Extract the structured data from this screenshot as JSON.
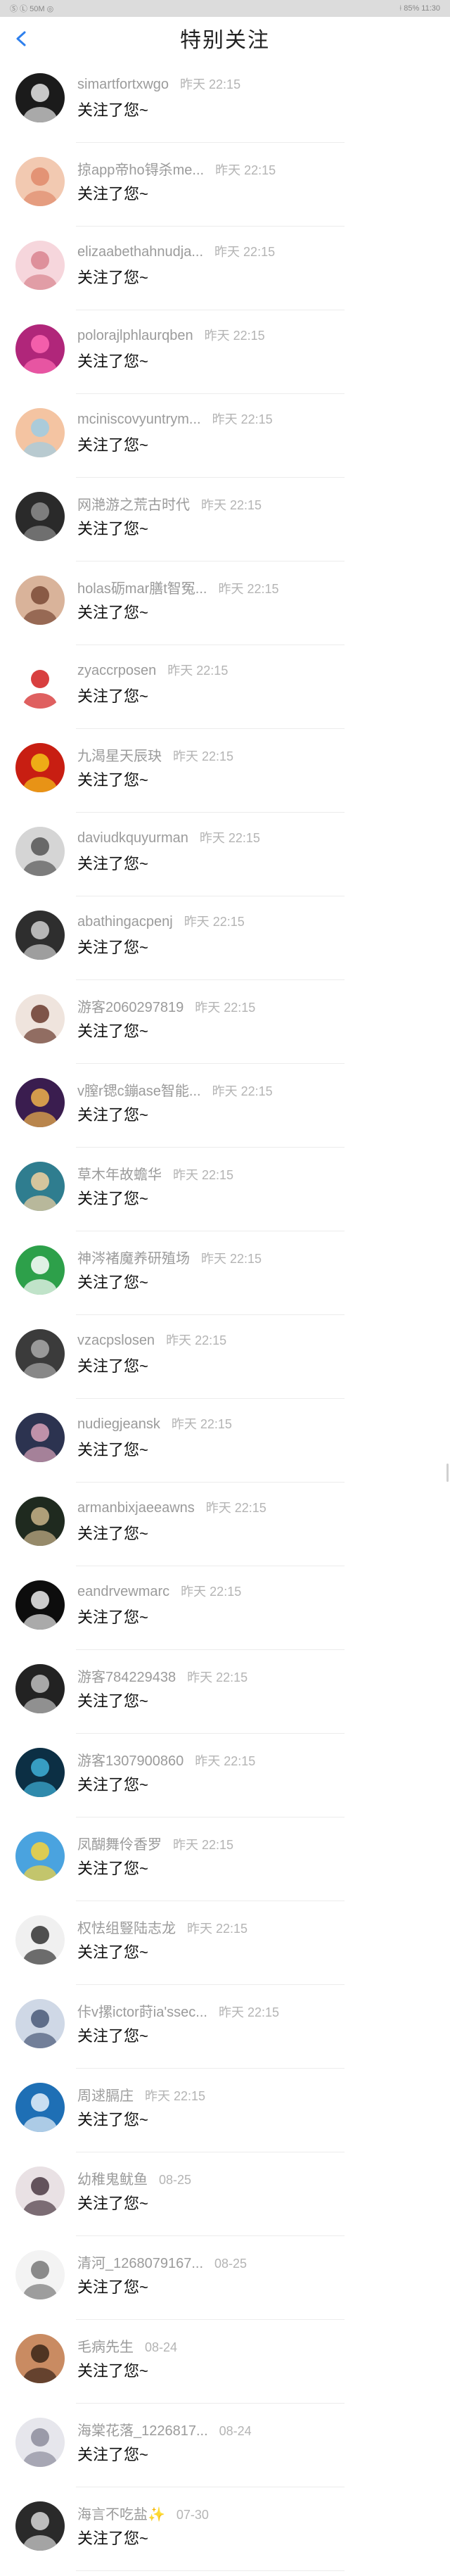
{
  "status_bar": {
    "left": "Ⓢ Ⓛ 50M  ◎  ",
    "right": "⟊ 85%  11:30"
  },
  "header": {
    "title": "特别关注",
    "back_icon": "chevron-left-icon"
  },
  "rows": [
    {
      "name": "simartfortxwgo",
      "time": "昨天 22:15",
      "message": "关注了您~",
      "avatar": {
        "bg": "#1b1b1b",
        "fg": "#e6e6e6"
      }
    },
    {
      "name": "掠app帝ho锝杀me...",
      "time": "昨天 22:15",
      "message": "关注了您~",
      "avatar": {
        "bg": "#f2c9b1",
        "fg": "#e08a6b"
      }
    },
    {
      "name": "elizaabethahnudja...",
      "time": "昨天 22:15",
      "message": "关注了您~",
      "avatar": {
        "bg": "#f6d6dc",
        "fg": "#d9848f"
      }
    },
    {
      "name": "polorajlphlaurqben",
      "time": "昨天 22:15",
      "message": "关注了您~",
      "avatar": {
        "bg": "#b0267a",
        "fg": "#ff69b4"
      }
    },
    {
      "name": "mciniscovyuntrym...",
      "time": "昨天 22:15",
      "message": "关注了您~",
      "avatar": {
        "bg": "#f4c4a2",
        "fg": "#9ecde4"
      }
    },
    {
      "name": "网滟游之荒古时代",
      "time": "昨天 22:15",
      "message": "关注了您~",
      "avatar": {
        "bg": "#2a2a2a",
        "fg": "#8d8d8d"
      }
    },
    {
      "name": "holas砺mar膳t智冤...",
      "time": "昨天 22:15",
      "message": "关注了您~",
      "avatar": {
        "bg": "#d9b39a",
        "fg": "#7a4a36"
      }
    },
    {
      "name": "zyaccrposen",
      "time": "昨天 22:15",
      "message": "关注了您~",
      "avatar": {
        "bg": "#ffffff",
        "fg": "#d11d1d"
      }
    },
    {
      "name": "九渴星天辰玦",
      "time": "昨天 22:15",
      "message": "关注了您~",
      "avatar": {
        "bg": "#c81e12",
        "fg": "#f5c518"
      }
    },
    {
      "name": "daviudkquyurman",
      "time": "昨天 22:15",
      "message": "关注了您~",
      "avatar": {
        "bg": "#d5d5d5",
        "fg": "#555555"
      }
    },
    {
      "name": "abathingacpenj",
      "time": "昨天 22:15",
      "message": "关注了您~",
      "avatar": {
        "bg": "#2e2e2e",
        "fg": "#cfcfcf"
      }
    },
    {
      "name": "游客2060297819",
      "time": "昨天 22:15",
      "message": "关注了您~",
      "avatar": {
        "bg": "#efe4dd",
        "fg": "#6a3b2e"
      }
    },
    {
      "name": "v膣r锶c鏰ase智能...",
      "time": "昨天 22:15",
      "message": "关注了您~",
      "avatar": {
        "bg": "#3a1d4f",
        "fg": "#f0b24b"
      }
    },
    {
      "name": "草木年故蟾华",
      "time": "昨天 22:15",
      "message": "关注了您~",
      "avatar": {
        "bg": "#2f7d8f",
        "fg": "#f2d1a0"
      }
    },
    {
      "name": "神涔褚魔养研殖场",
      "time": "昨天 22:15",
      "message": "关注了您~",
      "avatar": {
        "bg": "#2da04a",
        "fg": "#ffffff"
      }
    },
    {
      "name": "vzacpslosen",
      "time": "昨天 22:15",
      "message": "关注了您~",
      "avatar": {
        "bg": "#3b3b3b",
        "fg": "#aaaaaa"
      }
    },
    {
      "name": "nudiegjeansk",
      "time": "昨天 22:15",
      "message": "关注了您~",
      "avatar": {
        "bg": "#2c3350",
        "fg": "#d9a2b8"
      }
    },
    {
      "name": "armanbixjaeeawns",
      "time": "昨天 22:15",
      "message": "关注了您~",
      "avatar": {
        "bg": "#1f2a1f",
        "fg": "#c9b48a"
      }
    },
    {
      "name": "eandrvewmarc",
      "time": "昨天 22:15",
      "message": "关注了您~",
      "avatar": {
        "bg": "#0d0d0d",
        "fg": "#eeeeee"
      }
    },
    {
      "name": "游客784229438",
      "time": "昨天 22:15",
      "message": "关注了您~",
      "avatar": {
        "bg": "#222222",
        "fg": "#bfbfbf"
      }
    },
    {
      "name": "游客1307900860",
      "time": "昨天 22:15",
      "message": "关注了您~",
      "avatar": {
        "bg": "#0c2f44",
        "fg": "#3fb0d8"
      }
    },
    {
      "name": "凤醐舞伶香罗",
      "time": "昨天 22:15",
      "message": "关注了您~",
      "avatar": {
        "bg": "#4aa3df",
        "fg": "#f7d33b"
      }
    },
    {
      "name": "权怯组豎陆志龙",
      "time": "昨天 22:15",
      "message": "关注了您~",
      "avatar": {
        "bg": "#f0f0f0",
        "fg": "#333333"
      }
    },
    {
      "name": "佧v摞ictor莳ia'ssec...",
      "time": "昨天 22:15",
      "message": "关注了您~",
      "avatar": {
        "bg": "#cfd8e6",
        "fg": "#4a5a78"
      }
    },
    {
      "name": "周逑膈庄",
      "time": "昨天 22:15",
      "message": "关注了您~",
      "avatar": {
        "bg": "#1e6fb5",
        "fg": "#e8f2fb"
      }
    },
    {
      "name": "幼稚鬼鱿鱼",
      "time": "08-25",
      "message": "关注了您~",
      "avatar": {
        "bg": "#e9e1e4",
        "fg": "#4b3a44"
      }
    },
    {
      "name": "清河_1268079167...",
      "time": "08-25",
      "message": "关注了您~",
      "avatar": {
        "bg": "#f3f3f3",
        "fg": "#777777"
      }
    },
    {
      "name": "毛病先生",
      "time": "08-24",
      "message": "关注了您~",
      "avatar": {
        "bg": "#c98b62",
        "fg": "#3a2418"
      }
    },
    {
      "name": "海棠花落_1226817...",
      "time": "08-24",
      "message": "关注了您~",
      "avatar": {
        "bg": "#e6e6ec",
        "fg": "#8c8c9c"
      }
    },
    {
      "name": "海言不吃盐✨",
      "time": "07-30",
      "message": "关注了您~",
      "avatar": {
        "bg": "#2a2a2a",
        "fg": "#d8d8d8"
      }
    }
  ]
}
